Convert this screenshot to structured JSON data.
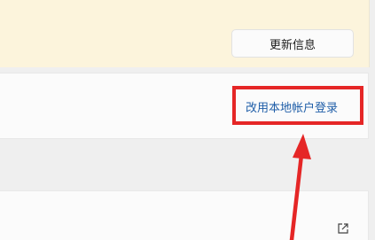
{
  "banner": {
    "update_button_label": "更新信息"
  },
  "account": {
    "local_account_link": "改用本地帐户登录"
  },
  "icons": {
    "open_external": "open-external-icon"
  },
  "annotation": {
    "highlight_color": "#e52626"
  }
}
